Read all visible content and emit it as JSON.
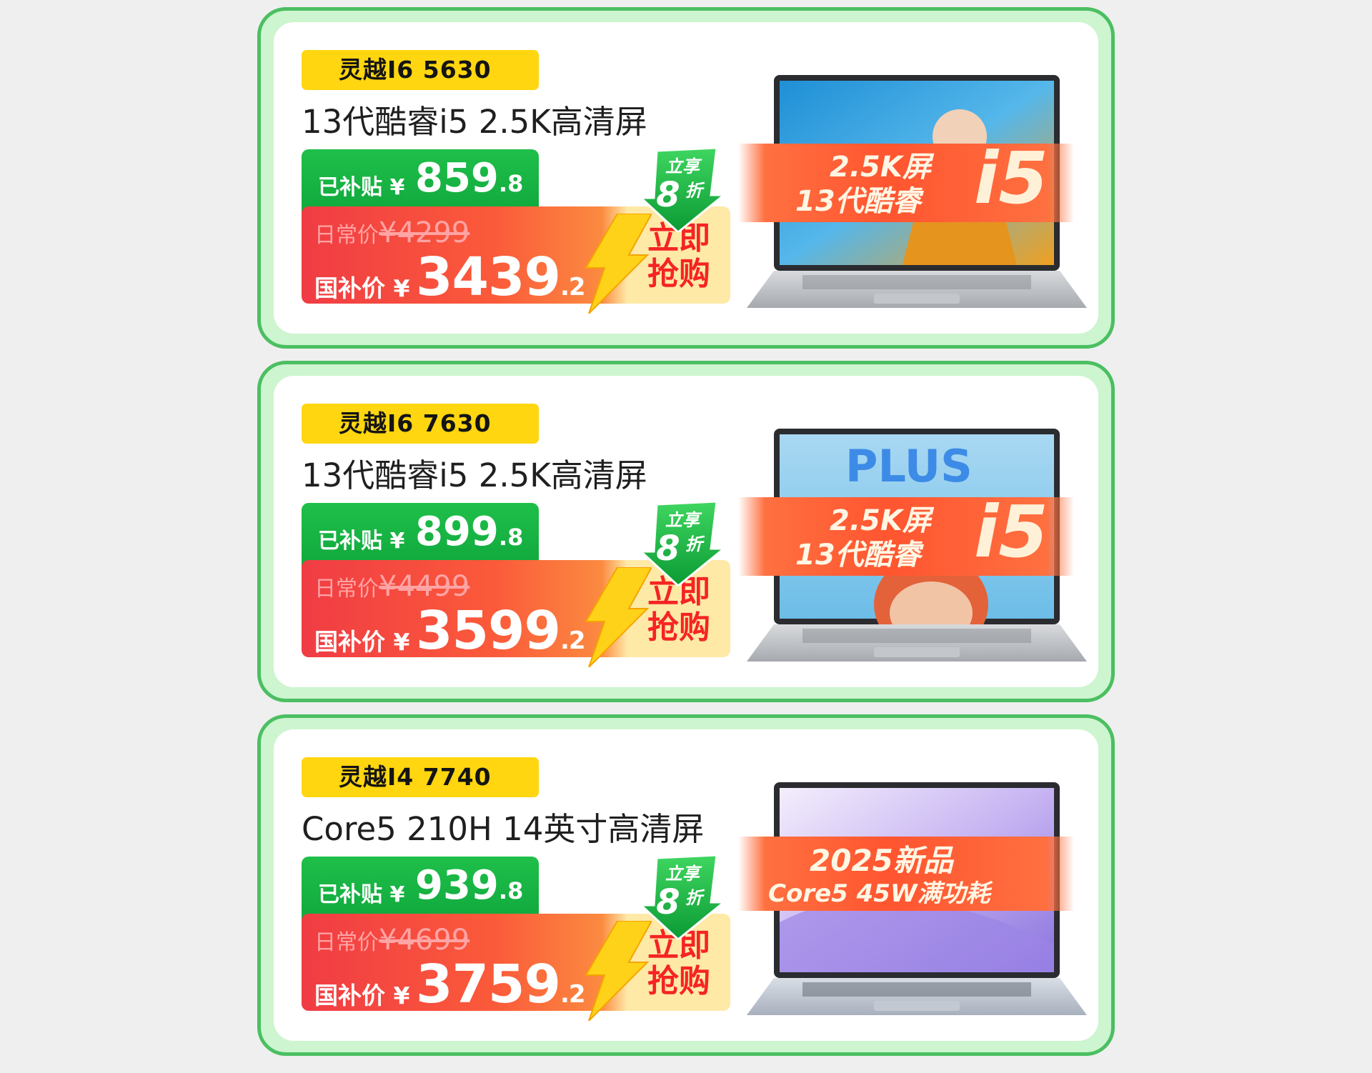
{
  "products": [
    {
      "model": "灵越I6 5630",
      "spec": "13代酷睿i5  2.5K高清屏",
      "subsidy_label": "已补贴 ¥",
      "subsidy_int": "859",
      "subsidy_dec": ".8",
      "daily_label": "日常价",
      "daily_price": "¥4299",
      "gov_label": "国补价 ¥",
      "gov_int": "3439",
      "gov_dec": ".2",
      "buy_line1": "立即",
      "buy_line2": "抢购",
      "discount_line1": "立享",
      "discount_num": "8",
      "discount_unit": "折",
      "ribbon_line1": "2.5K屏",
      "ribbon_line2": "13代酷睿",
      "ribbon_big": "i5",
      "screen_theme": "photo-woman"
    },
    {
      "model": "灵越I6 7630",
      "spec": "13代酷睿i5  2.5K高清屏",
      "subsidy_label": "已补贴 ¥",
      "subsidy_int": "899",
      "subsidy_dec": ".8",
      "daily_label": "日常价",
      "daily_price": "¥4499",
      "gov_label": "国补价 ¥",
      "gov_int": "3599",
      "gov_dec": ".2",
      "buy_line1": "立即",
      "buy_line2": "抢购",
      "discount_line1": "立享",
      "discount_num": "8",
      "discount_unit": "折",
      "ribbon_line1": "2.5K屏",
      "ribbon_line2": "13代酷睿",
      "ribbon_big": "i5",
      "screen_theme": "plus-red-hair"
    },
    {
      "model": "灵越I4 7740",
      "spec": "Core5 210H  14英寸高清屏",
      "subsidy_label": "已补贴 ¥",
      "subsidy_int": "939",
      "subsidy_dec": ".8",
      "daily_label": "日常价",
      "daily_price": "¥4699",
      "gov_label": "国补价 ¥",
      "gov_int": "3759",
      "gov_dec": ".2",
      "buy_line1": "立即",
      "buy_line2": "抢购",
      "discount_line1": "立享",
      "discount_num": "8",
      "discount_unit": "折",
      "ribbon_line1": "2025新品",
      "ribbon_line2": "Core5 45W满功耗",
      "ribbon_big": "",
      "screen_theme": "purple-wave"
    }
  ],
  "colors": {
    "card_border": "#4bbf62",
    "card_bg": "#cdf5cf",
    "badge": "#ffd60f",
    "subsidy_green": "#0ea63b",
    "price_red": "#f03c44",
    "buy_text": "#f52424",
    "ribbon": "#ff5530"
  }
}
